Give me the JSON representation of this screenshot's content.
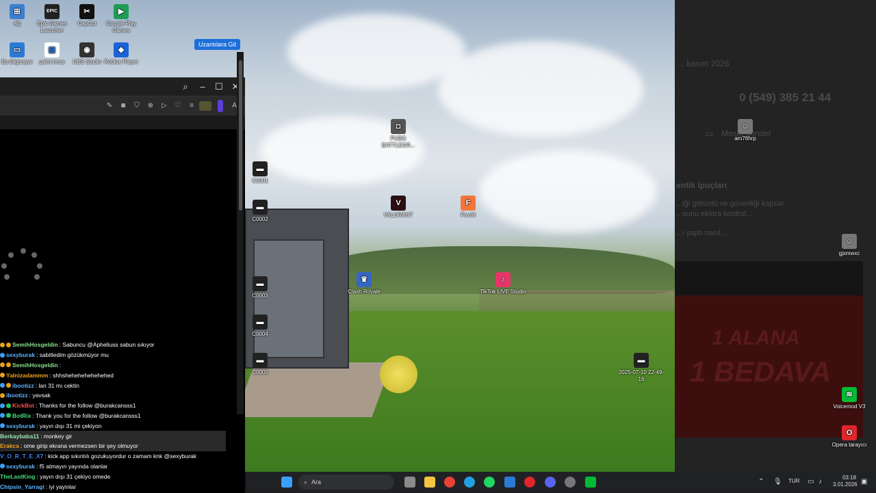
{
  "desktop_icons": [
    {
      "label": "Ağ",
      "color": "#3b7fcf",
      "glyph": "⊞"
    },
    {
      "label": "Epic Games Launcher",
      "color": "#222",
      "glyph": "EPIC"
    },
    {
      "label": "CapCut",
      "color": "#111",
      "glyph": "✂"
    },
    {
      "label": "Google Play Games",
      "color": "#1f9d55",
      "glyph": "▶"
    },
    {
      "label": "Bu bilgisayar",
      "color": "#2b7bd5",
      "glyph": "▭"
    },
    {
      "label": "paint teras",
      "color": "#fff",
      "glyph": "▤"
    },
    {
      "label": "OBS Studio",
      "color": "#333",
      "glyph": "◉"
    },
    {
      "label": "Roblox Player",
      "color": "#1a63d8",
      "glyph": "◆"
    },
    {
      "label": "PUBG BATTLEGR...",
      "color": "#555",
      "glyph": "◘"
    },
    {
      "label": "C0001",
      "color": "#222",
      "glyph": "▬"
    },
    {
      "label": "C0002",
      "color": "#222",
      "glyph": "▬"
    },
    {
      "label": "VALORANT",
      "color": "#2b0f12",
      "glyph": "V"
    },
    {
      "label": "FiveM",
      "color": "#f2763a",
      "glyph": "F"
    },
    {
      "label": "C0003",
      "color": "#222",
      "glyph": "▬"
    },
    {
      "label": "Clash Royale",
      "color": "#3567c4",
      "glyph": "♛"
    },
    {
      "label": "TikTok LIVE Studio",
      "color": "#e6356b",
      "glyph": "♪"
    },
    {
      "label": "C0004",
      "color": "#222",
      "glyph": "▬"
    },
    {
      "label": "C0005",
      "color": "#222",
      "glyph": "▬"
    },
    {
      "label": "2025-07-10 22-49-16",
      "color": "#222",
      "glyph": "▬"
    },
    {
      "label": "am76hrp",
      "color": "#777",
      "glyph": "☺"
    },
    {
      "label": "gjxmwxc",
      "color": "#777",
      "glyph": "☺"
    },
    {
      "label": "Voicemod V3",
      "color": "#0b3",
      "glyph": "≋"
    },
    {
      "label": "Opera tarayıcı",
      "color": "#e0262c",
      "glyph": "O"
    }
  ],
  "right_panel": {
    "date_text": "... kasım 2026",
    "phone": "0 (549) 385 21 44",
    "link": "Mesaj gönder",
    "heading": "entik ipuçları",
    "line1": "...iği görüntü ve güvenliği kapsar",
    "line2": "...sunu ekstra kontrol...",
    "line3": "...i yaptı nasıl...",
    "ad1": "1 ALANA",
    "ad2": "1 BEDAVA"
  },
  "browser": {
    "extensions_button": "Uzantılara Git",
    "ai_label": "AI"
  },
  "chat": [
    {
      "user": "SemihHosgeldin",
      "text": ": Sabuncu @Apheliuss sabun sıkıyor",
      "color": "#8be28b",
      "badges": [
        "#e6a11c",
        "#e6a11c"
      ]
    },
    {
      "user": "sexyburak",
      "text": ": sabitledim gözükmüyor mu",
      "color": "#5eb5ff",
      "badges": [
        "#3aa0ff"
      ]
    },
    {
      "user": "SemihHosgeldin",
      "text": ":",
      "color": "#8be28b",
      "badges": [
        "#e6a11c",
        "#e6a11c"
      ]
    },
    {
      "user": "Yalnizadammm",
      "text": ": shhshehehehehehehed",
      "color": "#f0a020",
      "badges": [
        "#e6a11c"
      ]
    },
    {
      "user": "ibootizz",
      "text": ": lan 31 mı cektin",
      "color": "#5eb5ff",
      "badges": [
        "#3aa0ff",
        "#e6a11c"
      ]
    },
    {
      "user": "ibootizz",
      "text": ": yavsak",
      "color": "#5eb5ff",
      "badges": [
        "#e6a11c"
      ]
    },
    {
      "user": "KickBot",
      "text": ": Thanks for the follow @burakcansss1",
      "color": "#ff4d4d",
      "badges": [
        "#3aa0ff",
        "#22c55e"
      ]
    },
    {
      "user": "BotRix",
      "text": ": Thank you for the follow @burakcansss1",
      "color": "#4ade80",
      "badges": [
        "#3aa0ff",
        "#22c55e"
      ]
    },
    {
      "user": "sexyburak",
      "text": ": yayın dışı 31 mi çekiyon",
      "color": "#5eb5ff",
      "badges": [
        "#3aa0ff"
      ]
    },
    {
      "user": "Berkaybaba11",
      "text": ": monkey gir",
      "color": "#9ae6b4",
      "badges": [],
      "bg": true
    },
    {
      "user": "Erakca",
      "text": ": ome girip ekrana vermezsen bir şey olmuyor",
      "color": "#f0a020",
      "badges": [],
      "bg": true
    },
    {
      "user": "V_O_R_T_E_X7",
      "text": ": kick app sıkıntılı gozukuyordur o zamam knk @sexyburak",
      "color": "#3b82f6",
      "badges": []
    },
    {
      "user": "sexyburak",
      "text": ": f5 atmayın yayında olanlar",
      "color": "#5eb5ff",
      "badges": [
        "#3aa0ff"
      ]
    },
    {
      "user": "TheLastKing",
      "text": ": yayın dışı 31 çekiyo omede",
      "color": "#4ade80",
      "badges": []
    },
    {
      "user": "Chipsin_Yarragi",
      "text": ": iyi yayinlar",
      "color": "#5eb5ff",
      "badges": []
    }
  ],
  "taskbar": {
    "search_placeholder": "Ara",
    "lang": "TUR",
    "time": "03:18",
    "date": "3.01.2026"
  }
}
